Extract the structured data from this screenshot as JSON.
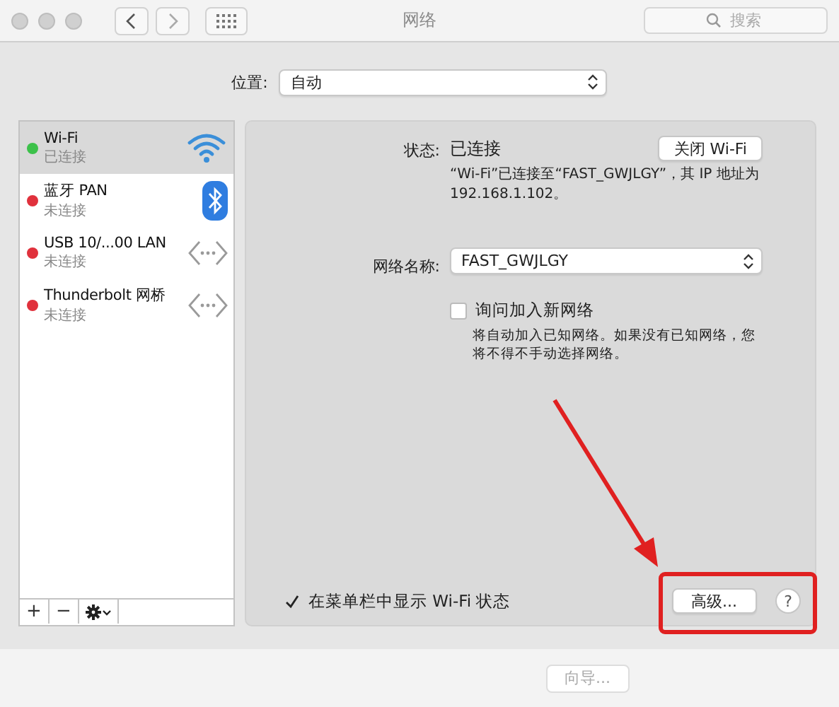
{
  "window": {
    "title": "网络"
  },
  "search": {
    "placeholder": "搜索"
  },
  "location": {
    "label": "位置:",
    "value": "自动"
  },
  "services": [
    {
      "name": "Wi-Fi",
      "status": "已连接",
      "color": "#3cc14a",
      "kind": "wifi",
      "selected": true
    },
    {
      "name": "蓝牙 PAN",
      "status": "未连接",
      "color": "#e0313c",
      "kind": "bluetooth",
      "selected": false
    },
    {
      "name": "USB 10/...00 LAN",
      "status": "未连接",
      "color": "#e0313c",
      "kind": "ethernet",
      "selected": false
    },
    {
      "name": "Thunderbolt 网桥",
      "status": "未连接",
      "color": "#e0313c",
      "kind": "ethernet",
      "selected": false
    }
  ],
  "sidebar_toolbar": [
    "+",
    "−"
  ],
  "detail": {
    "status_label": "状态:",
    "status_value": "已连接",
    "toggle_button": "关闭 Wi-Fi",
    "description": "“Wi-Fi”已连接至“FAST_GWJLGY”，其 IP 地址为 192.168.1.102。",
    "network_label": "网络名称:",
    "network_value": "FAST_GWJLGY",
    "ask_join": {
      "label": "询问加入新网络",
      "checked": false,
      "hint": "将自动加入已知网络。如果没有已知网络，您将不得不手动选择网络。"
    },
    "menubar": {
      "label": "在菜单栏中显示 Wi-Fi 状态",
      "checked": true
    },
    "advanced_button": "高级...",
    "help": "?"
  },
  "footer": {
    "assistant_button": "向导...",
    "disabled": true
  }
}
